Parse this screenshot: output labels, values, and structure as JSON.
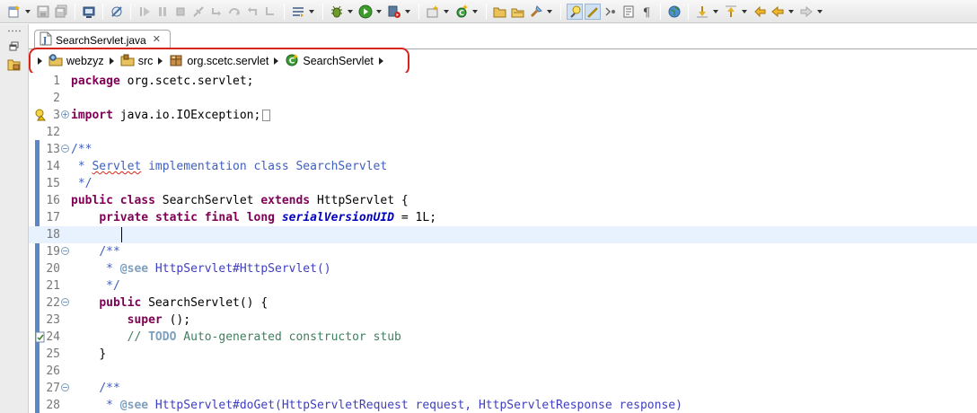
{
  "toolbar": {
    "icons": [
      "new-icon",
      "save-icon",
      "save-all-icon",
      "print-icon",
      "skip-breakpoints-icon",
      "resume-icon",
      "suspend-icon",
      "terminate-icon",
      "disconnect-icon",
      "step-into-icon",
      "step-over-icon",
      "step-return-icon",
      "drop-to-frame-icon",
      "use-step-filters-icon",
      "debug-icon",
      "run-icon",
      "run-server-icon",
      "new-server-icon",
      "new-java-class-icon",
      "open-type-icon",
      "open-task-icon",
      "search-icon",
      "toggle-mark-occurrences-icon",
      "toggle-highlight-icon",
      "show-whitespace-icon",
      "block-selection-icon",
      "toggle-word-wrap-icon",
      "globe-icon",
      "next-annotation-icon",
      "previous-annotation-icon",
      "last-edit-location-icon",
      "back-icon",
      "forward-icon"
    ]
  },
  "editor_tab": {
    "title": "SearchServlet.java",
    "icon": "java-file-icon",
    "close_glyph": "✕"
  },
  "breadcrumb": {
    "items": [
      {
        "label": "webzyz",
        "icon": "project-icon"
      },
      {
        "label": "src",
        "icon": "source-folder-icon"
      },
      {
        "label": "org.scetc.servlet",
        "icon": "package-icon"
      },
      {
        "label": "SearchServlet",
        "icon": "class-icon"
      }
    ],
    "highlight_color": "#d9241c"
  },
  "code": {
    "current_line": "18",
    "lines": [
      {
        "n": "1",
        "segments": [
          [
            "kw",
            "package"
          ],
          [
            "",
            "org.scetc.servlet;"
          ]
        ]
      },
      {
        "n": "2",
        "segments": []
      },
      {
        "n": "3",
        "fold": "+",
        "gutter": "warning-lightbulb-icon",
        "segments": [
          [
            "kw",
            "import"
          ],
          [
            "",
            "java.io.IOException;"
          ]
        ],
        "collapsed": true
      },
      {
        "n": "12",
        "segments": []
      },
      {
        "n": "13",
        "fold": "−",
        "segments": [
          [
            "jdoc",
            "/**"
          ]
        ]
      },
      {
        "n": "14",
        "segments": [
          [
            "jdoc",
            " * "
          ],
          [
            "jdoc-squig",
            "Servlet"
          ],
          [
            "jdoc",
            " implementation class SearchServlet"
          ]
        ]
      },
      {
        "n": "15",
        "segments": [
          [
            "jdoc",
            " */"
          ]
        ]
      },
      {
        "n": "16",
        "segments": [
          [
            "kw",
            "public"
          ],
          [
            "kw",
            "class"
          ],
          [
            "",
            "SearchServlet"
          ],
          [
            "kw",
            "extends"
          ],
          [
            "",
            "HttpServlet {"
          ]
        ]
      },
      {
        "n": "17",
        "segments": [
          [
            "indent",
            "    "
          ],
          [
            "kw",
            "private"
          ],
          [
            "kw",
            "static"
          ],
          [
            "kw",
            "final"
          ],
          [
            "kw",
            "long"
          ],
          [
            "fld",
            "serialVersionUID"
          ],
          [
            "",
            "= 1L;"
          ]
        ]
      },
      {
        "n": "18",
        "segments": []
      },
      {
        "n": "19",
        "fold": "−",
        "segments": [
          [
            "indent",
            "    "
          ],
          [
            "jdoc",
            "/**"
          ]
        ]
      },
      {
        "n": "20",
        "segments": [
          [
            "indent",
            "    "
          ],
          [
            "jdoc",
            " * "
          ],
          [
            "jtag",
            "@see"
          ],
          [
            "jlink",
            " HttpServlet#HttpServlet()"
          ]
        ]
      },
      {
        "n": "21",
        "segments": [
          [
            "indent",
            "    "
          ],
          [
            "jdoc",
            " */"
          ]
        ]
      },
      {
        "n": "22",
        "fold": "−",
        "segments": [
          [
            "indent",
            "    "
          ],
          [
            "kw",
            "public"
          ],
          [
            "",
            "SearchServlet() {"
          ]
        ]
      },
      {
        "n": "23",
        "segments": [
          [
            "indent",
            "        "
          ],
          [
            "kw",
            "super"
          ],
          [
            "",
            "();"
          ]
        ]
      },
      {
        "n": "24",
        "gutter": "task-icon",
        "segments": [
          [
            "indent",
            "        "
          ],
          [
            "cmt",
            "// "
          ],
          [
            "todo",
            "TODO"
          ],
          [
            "cmt",
            " Auto-generated constructor stub"
          ]
        ]
      },
      {
        "n": "25",
        "segments": [
          [
            "indent",
            "    "
          ],
          [
            "",
            "}"
          ]
        ]
      },
      {
        "n": "26",
        "segments": []
      },
      {
        "n": "27",
        "fold": "−",
        "segments": [
          [
            "indent",
            "    "
          ],
          [
            "jdoc",
            "/**"
          ]
        ]
      },
      {
        "n": "28",
        "segments": [
          [
            "indent",
            "    "
          ],
          [
            "jdoc",
            " * "
          ],
          [
            "jtag",
            "@see"
          ],
          [
            "jlink",
            " HttpServlet#doGet(HttpServletRequest request, HttpServletResponse response)"
          ]
        ]
      }
    ]
  }
}
